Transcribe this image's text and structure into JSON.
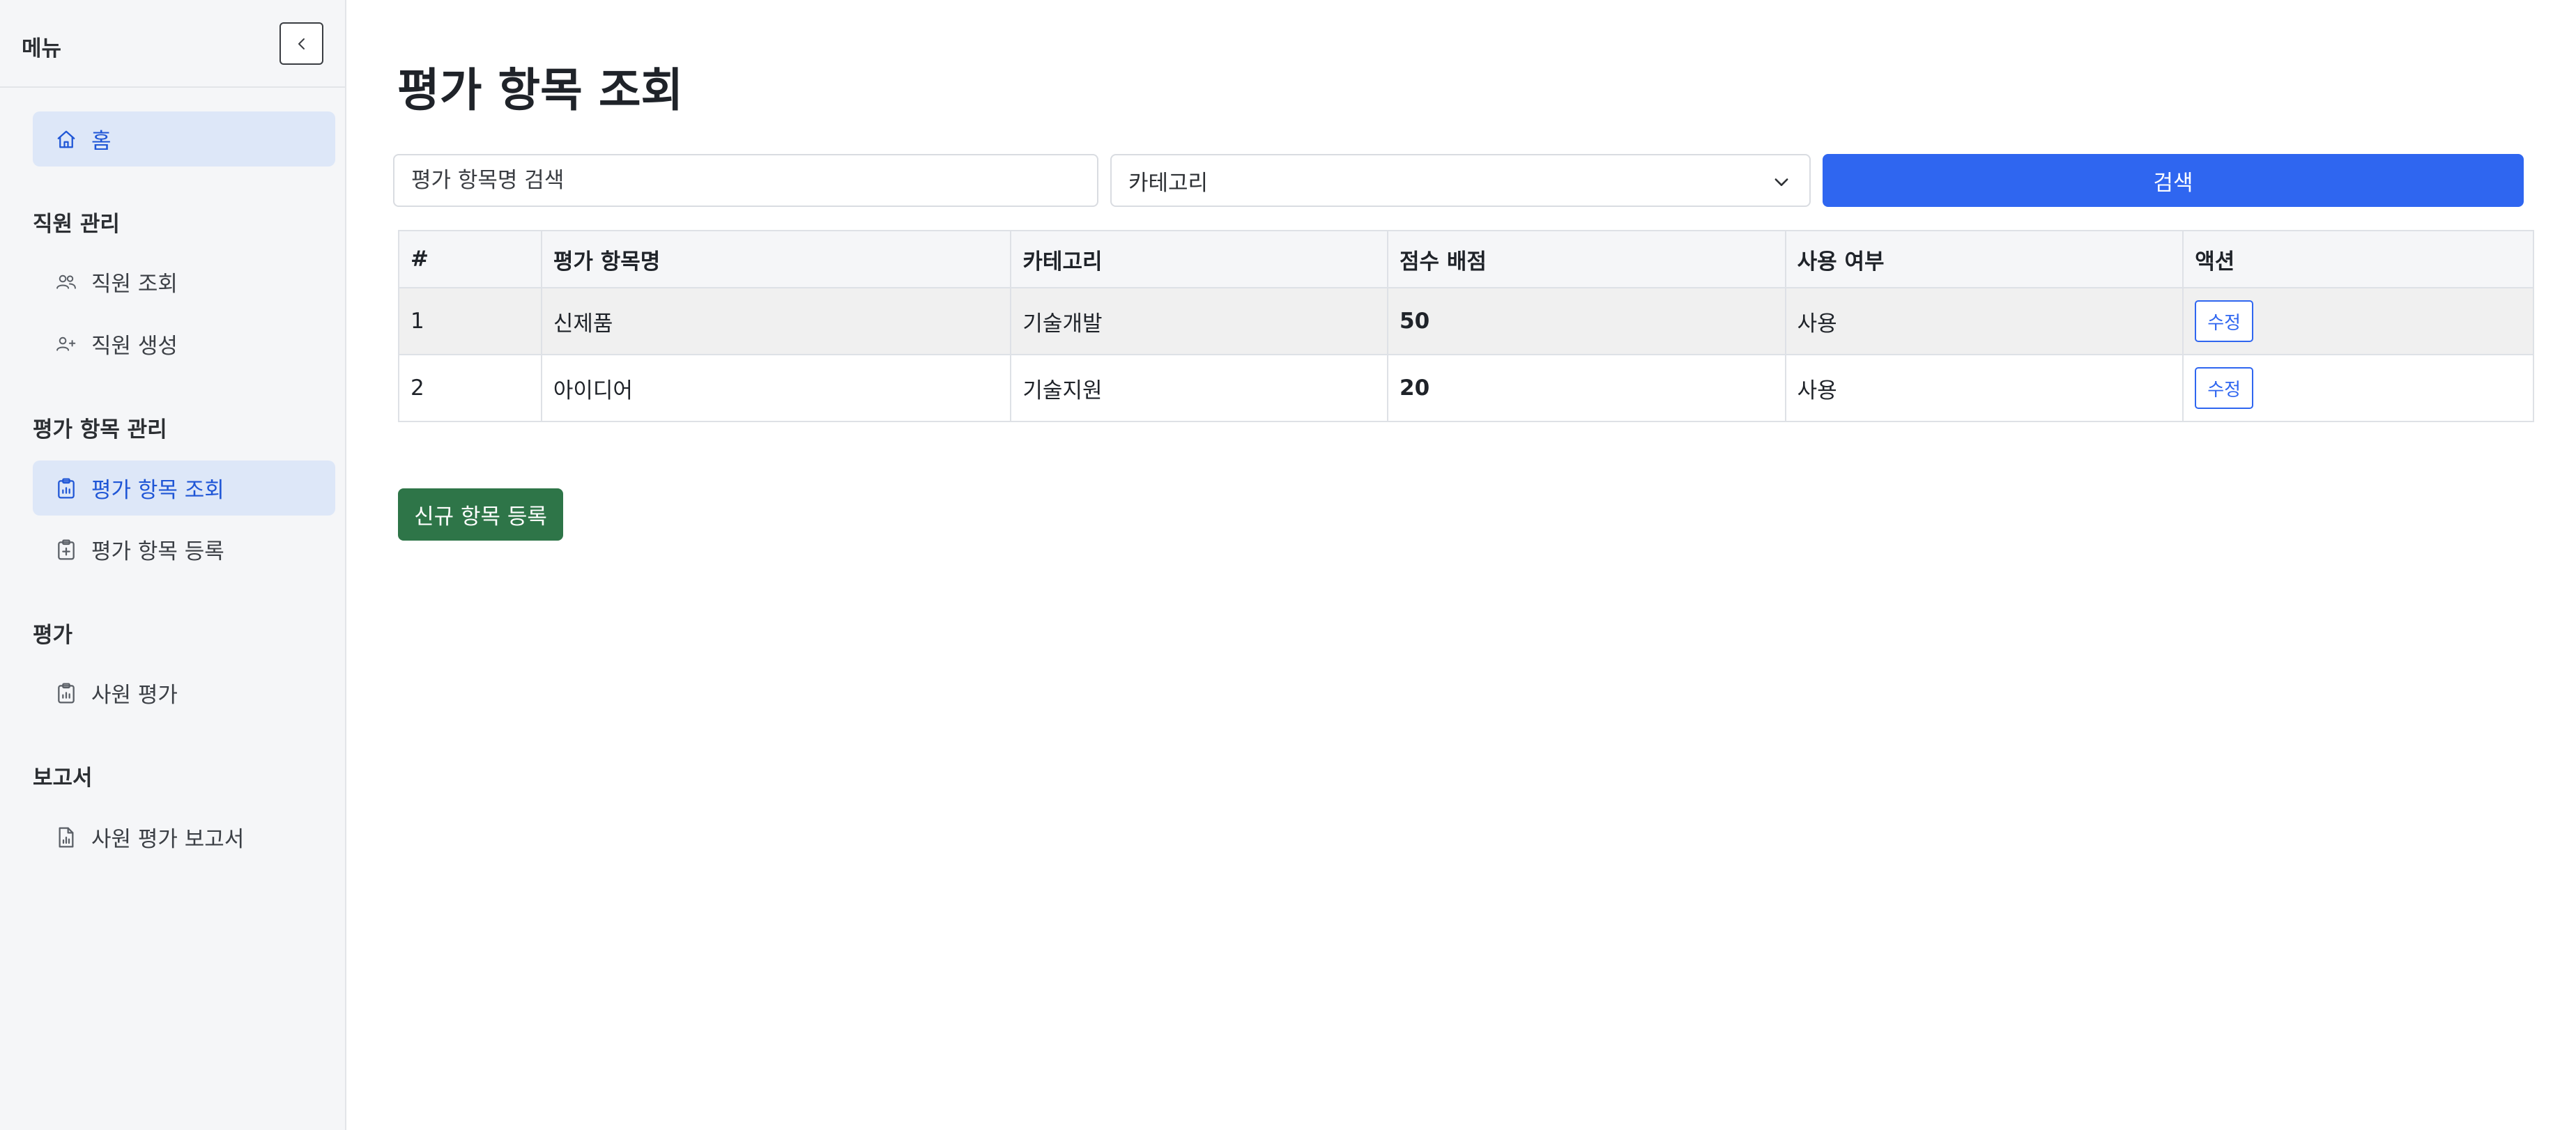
{
  "sidebar": {
    "title": "메뉴",
    "home": "홈",
    "sections": [
      {
        "title": "직원 관리",
        "items": [
          "직원 조회",
          "직원 생성"
        ]
      },
      {
        "title": "평가 항목 관리",
        "items": [
          "평가 항목 조회",
          "평가 항목 등록"
        ]
      },
      {
        "title": "평가",
        "items": [
          "사원 평가"
        ]
      },
      {
        "title": "보고서",
        "items": [
          "사원 평가 보고서"
        ]
      }
    ]
  },
  "main": {
    "title": "평가 항목 조회",
    "search": {
      "placeholder": "평가 항목명 검색",
      "value": ""
    },
    "category": {
      "selected": "카테고리"
    },
    "search_button": "검색",
    "table": {
      "headers": [
        "#",
        "평가 항목명",
        "카테고리",
        "점수 배점",
        "사용 여부",
        "액션"
      ],
      "rows": [
        {
          "no": "1",
          "name": "신제품",
          "category": "기술개발",
          "score": "50",
          "use": "사용",
          "action": "수정"
        },
        {
          "no": "2",
          "name": "아이디어",
          "category": "기술지원",
          "score": "20",
          "use": "사용",
          "action": "수정"
        }
      ]
    },
    "new_button": "신규 항목 등록"
  },
  "colors": {
    "accent": "#2f66f0",
    "active_bg": "#dde7f8",
    "success": "#2e7548",
    "sidebar_bg": "#f5f6f8"
  },
  "icons": {
    "collapse": "chevron-left-icon",
    "home": "home-icon",
    "users": "users-icon",
    "user_add": "user-plus-icon",
    "clipboard_list": "clipboard-list-icon",
    "clipboard_add": "clipboard-plus-icon",
    "clipboard": "clipboard-icon",
    "report": "file-chart-icon",
    "dropdown": "chevron-down-icon"
  }
}
